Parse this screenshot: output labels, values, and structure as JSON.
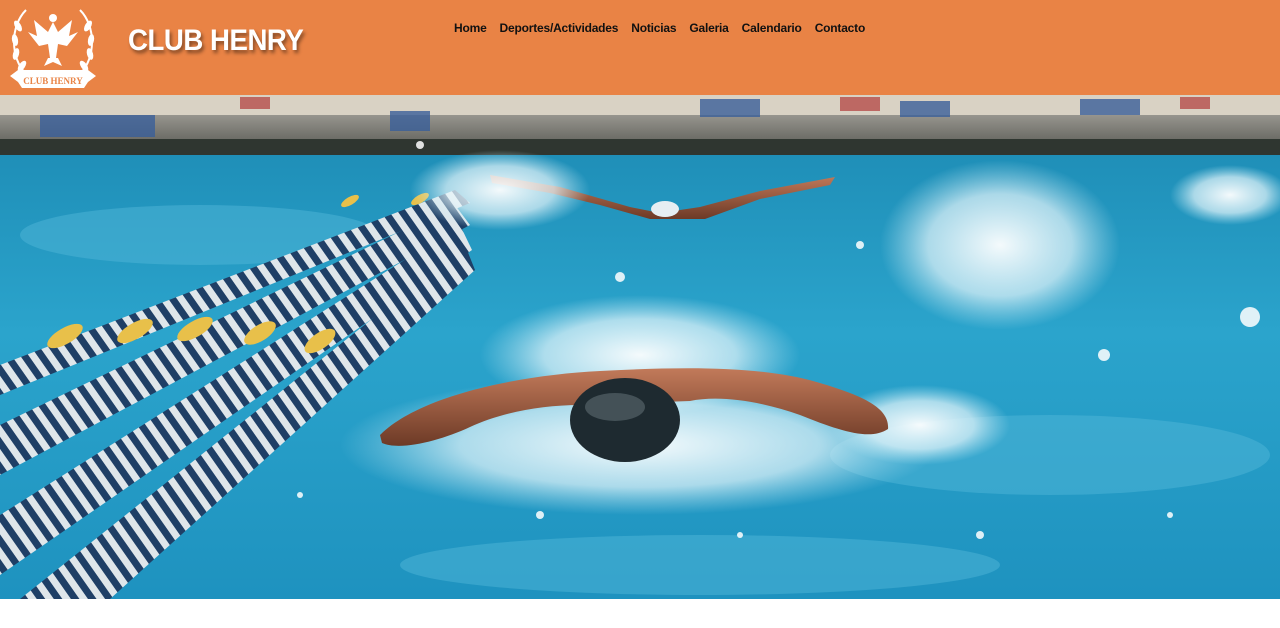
{
  "site": {
    "brand": "CLUB HENRY",
    "logo_text": "CLUB HENRY"
  },
  "nav": {
    "items": [
      {
        "label": "Home"
      },
      {
        "label": "Deportes/Actividades"
      },
      {
        "label": "Noticias"
      },
      {
        "label": "Galeria"
      },
      {
        "label": "Calendario"
      },
      {
        "label": "Contacto"
      }
    ]
  },
  "colors": {
    "header_bg": "#e98345",
    "brand_text": "#ffffff",
    "nav_text": "#111111",
    "water": "#2a9cc4"
  },
  "hero": {
    "image": "swimmer-butterfly-pool-photo"
  }
}
